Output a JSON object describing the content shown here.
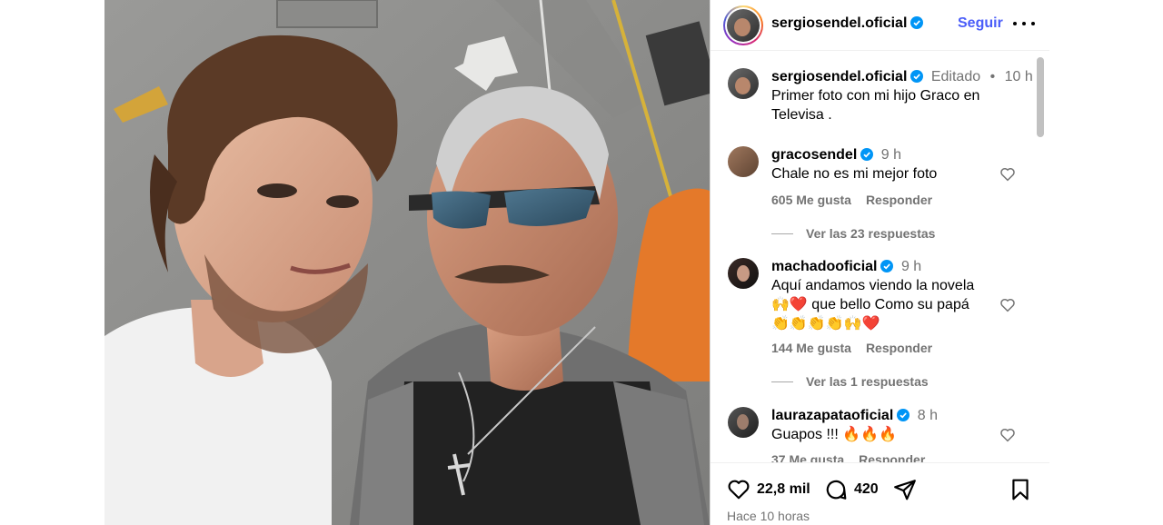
{
  "post": {
    "username": "sergiosendel.oficial",
    "follow_label": "Seguir",
    "caption": {
      "edited_label": "Editado",
      "separator": "•",
      "time": "10 h",
      "text": "Primer foto con mi hijo Graco en Televisa ."
    },
    "likes_count": "22,8 mil",
    "comments_count": "420",
    "posted_ago": "Hace 10 horas"
  },
  "comments": [
    {
      "username": "gracosendel",
      "time": "9 h",
      "text": "Chale no es mi mejor foto",
      "likes": "605 Me gusta",
      "reply_label": "Responder",
      "view_replies": "Ver las 23 respuestas"
    },
    {
      "username": "machadooficial",
      "time": "9 h",
      "text": "Aquí andamos viendo la novela 🙌❤️ que bello Como su papá 👏👏👏👏🙌❤️",
      "likes": "144 Me gusta",
      "reply_label": "Responder",
      "view_replies": "Ver las 1 respuestas"
    },
    {
      "username": "laurazapataoficial",
      "time": "8 h",
      "text": "Guapos !!! 🔥🔥🔥",
      "likes": "37 Me gusta",
      "reply_label": "Responder"
    }
  ],
  "icons": {
    "more": "more-horizontal-icon",
    "verified": "verified-badge-icon",
    "heart": "heart-icon",
    "comment": "comment-bubble-icon",
    "share": "paper-plane-icon",
    "save": "bookmark-icon"
  },
  "colors": {
    "accent": "#4a5df9",
    "verified": "#0095f6",
    "muted_text": "#737373"
  }
}
